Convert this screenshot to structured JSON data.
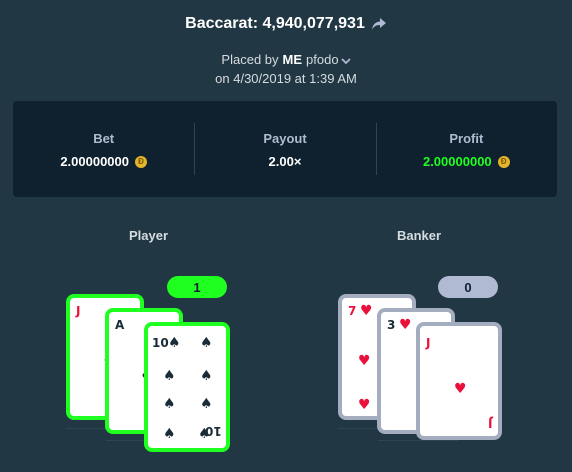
{
  "bet_title": "Baccarat: 4,940,077,931",
  "placed_by_prefix": "Placed by",
  "me_label": "ME",
  "username": "pfodo",
  "date": "on 4/30/2019 at 1:39 AM",
  "stats": {
    "bet_label": "Bet",
    "bet_value": "2.00000000",
    "payout_label": "Payout",
    "payout_value": "2.00×",
    "profit_label": "Profit",
    "profit_value": "2.00000000"
  },
  "player": {
    "label": "Player",
    "score": "1",
    "cards": [
      {
        "rank": "J",
        "suit": "diamonds"
      },
      {
        "rank": "A",
        "suit": "clubs"
      },
      {
        "rank": "10",
        "suit": "spades"
      }
    ]
  },
  "banker": {
    "label": "Banker",
    "score": "0",
    "cards": [
      {
        "rank": "7",
        "suit": "hearts"
      },
      {
        "rank": "3",
        "suit": "hearts"
      },
      {
        "rank": "J",
        "suit": "hearts"
      }
    ]
  },
  "colors": {
    "background": "#213743",
    "panel": "#0f212e",
    "win": "#1fff20",
    "lose": "#b1bad3",
    "red_suit": "#e9113c"
  },
  "icons": {
    "share": "share-arrow-icon",
    "chevron": "chevron-down-icon",
    "coin": "coin-icon"
  }
}
